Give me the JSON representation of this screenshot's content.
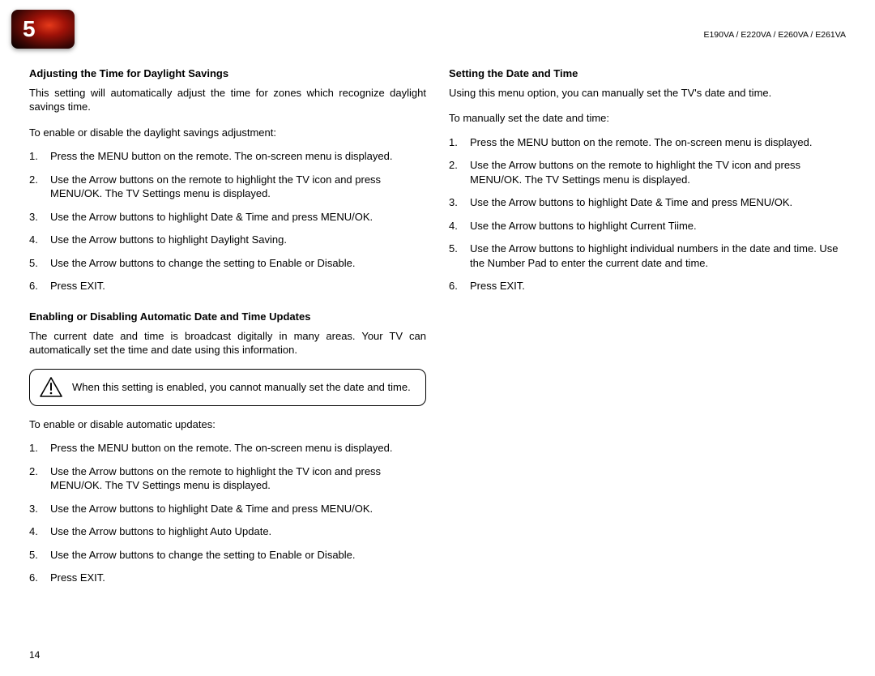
{
  "chapter_number": "5",
  "model_header": "E190VA / E220VA / E260VA / E261VA",
  "page_number": "14",
  "left": {
    "section1": {
      "heading": "Adjusting the Time for Daylight Savings",
      "intro1": "This setting will automatically adjust the time for zones which recognize daylight savings time.",
      "intro2": "To enable or disable the daylight savings adjustment:",
      "steps": [
        "Press the MENU button on the remote. The on-screen menu is displayed.",
        "Use the Arrow buttons on the remote to highlight the TV icon and press MENU/OK. The TV Settings menu is displayed.",
        "Use the Arrow buttons to highlight Date & Time and press MENU/OK.",
        "Use the Arrow buttons to highlight Daylight Saving.",
        "Use the Arrow buttons to change the setting to Enable or Disable.",
        "Press EXIT."
      ]
    },
    "section2": {
      "heading": "Enabling or Disabling Automatic Date and Time Updates",
      "intro1": "The current date and time is broadcast digitally in many areas. Your TV can automatically set the time and date using this information.",
      "callout": "When this setting is enabled, you cannot manually set the date and time.",
      "intro2": "To enable or disable automatic updates:",
      "steps": [
        "Press the MENU button on the remote. The on-screen menu is displayed.",
        "Use the Arrow buttons on the remote to highlight the TV icon and press MENU/OK. The TV Settings menu is displayed.",
        "Use the Arrow buttons to highlight Date & Time and press MENU/OK.",
        "Use the Arrow buttons to highlight Auto Update.",
        "Use the Arrow buttons to change the setting to Enable or Disable.",
        "Press EXIT."
      ]
    }
  },
  "right": {
    "section1": {
      "heading": "Setting the Date and Time",
      "intro1": "Using this menu option, you can manually set the TV's date and time.",
      "intro2": "To manually set the date and time:",
      "steps": [
        "Press the MENU button on the remote. The on-screen menu is displayed.",
        "Use the Arrow buttons on the remote to highlight the TV icon and press MENU/OK. The TV Settings menu is displayed.",
        "Use the Arrow buttons to highlight Date & Time and press MENU/OK.",
        "Use the Arrow buttons to highlight Current Tiime.",
        "Use the Arrow buttons to highlight individual numbers in the date and time. Use the Number Pad to enter the current date and time.",
        "Press EXIT."
      ]
    }
  }
}
